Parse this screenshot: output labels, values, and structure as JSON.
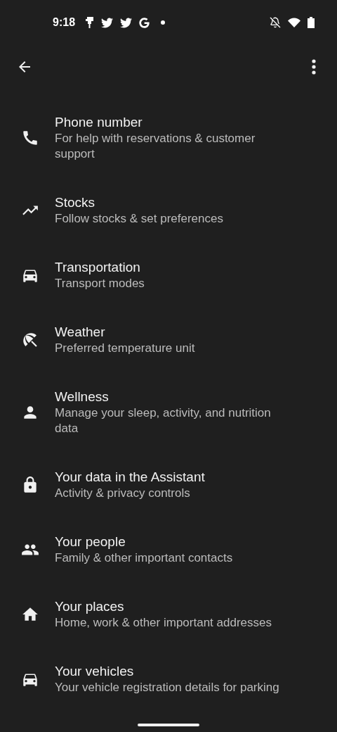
{
  "status_bar": {
    "time": "9:18"
  },
  "items": [
    {
      "title": "Phone number",
      "subtitle": "For help with reservations & customer support"
    },
    {
      "title": "Stocks",
      "subtitle": "Follow stocks & set preferences"
    },
    {
      "title": "Transportation",
      "subtitle": "Transport modes"
    },
    {
      "title": "Weather",
      "subtitle": "Preferred temperature unit"
    },
    {
      "title": "Wellness",
      "subtitle": "Manage your sleep, activity, and nutrition data"
    },
    {
      "title": "Your data in the Assistant",
      "subtitle": "Activity & privacy controls"
    },
    {
      "title": "Your people",
      "subtitle": "Family & other important contacts"
    },
    {
      "title": "Your places",
      "subtitle": "Home, work & other important addresses"
    },
    {
      "title": "Your vehicles",
      "subtitle": "Your vehicle registration details for parking"
    }
  ]
}
